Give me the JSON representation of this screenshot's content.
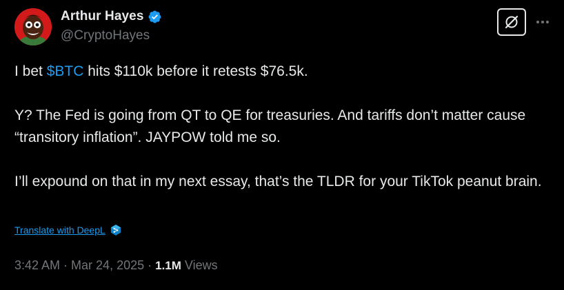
{
  "author": {
    "display_name": "Arthur Hayes",
    "handle": "@CryptoHayes",
    "verified": true,
    "avatar_icon": "cartoon-avatar-icon"
  },
  "header_actions": {
    "grok_icon": "grok-icon",
    "more_icon": "more-options-icon"
  },
  "tweet": {
    "line1_prefix": "I bet ",
    "cashtag": "$BTC",
    "line1_suffix": " hits $110k before it retests $76.5k.",
    "paragraph2": "Y? The Fed is going from QT to QE for treasuries. And tariffs don’t matter cause “transitory inflation”. JAYPOW told me so.",
    "paragraph3": "I’ll expound on that in my next essay, that’s the TLDR for your TikTok peanut brain."
  },
  "translate": {
    "label": "Translate with DeepL",
    "icon": "deepl-icon"
  },
  "meta": {
    "time": "3:42 AM",
    "separator": " · ",
    "date": "Mar 24, 2025",
    "views_count": "1.1M",
    "views_label": " Views"
  },
  "colors": {
    "background": "#000000",
    "text": "#e7e9ea",
    "secondary": "#71767b",
    "accent": "#1d9bf0"
  }
}
